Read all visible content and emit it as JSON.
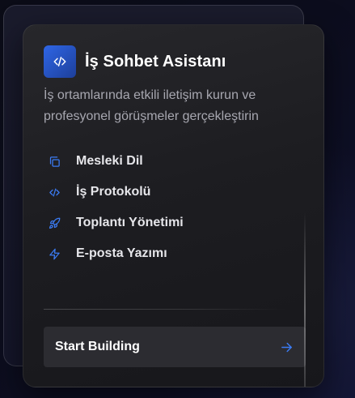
{
  "card": {
    "title": "İş Sohbet Asistanı",
    "description": "İş ortamlarında etkili iletişim kurun ve profesyonel görüşmeler gerçekleştirin",
    "logo_icon": "code-icon",
    "features": [
      {
        "label": "Mesleki Dil",
        "icon": "copy-icon"
      },
      {
        "label": "İş Protokolü",
        "icon": "code-icon"
      },
      {
        "label": "Toplantı Yönetimi",
        "icon": "rocket-icon"
      },
      {
        "label": "E-posta Yazımı",
        "icon": "lightning-icon"
      }
    ],
    "cta": {
      "label": "Start Building",
      "icon": "arrow-right-icon"
    }
  },
  "colors": {
    "accent": "#3b7cf5",
    "card_background": "#1d1d21",
    "page_background": "#0c0d1d",
    "button_background": "#2c2c31"
  }
}
